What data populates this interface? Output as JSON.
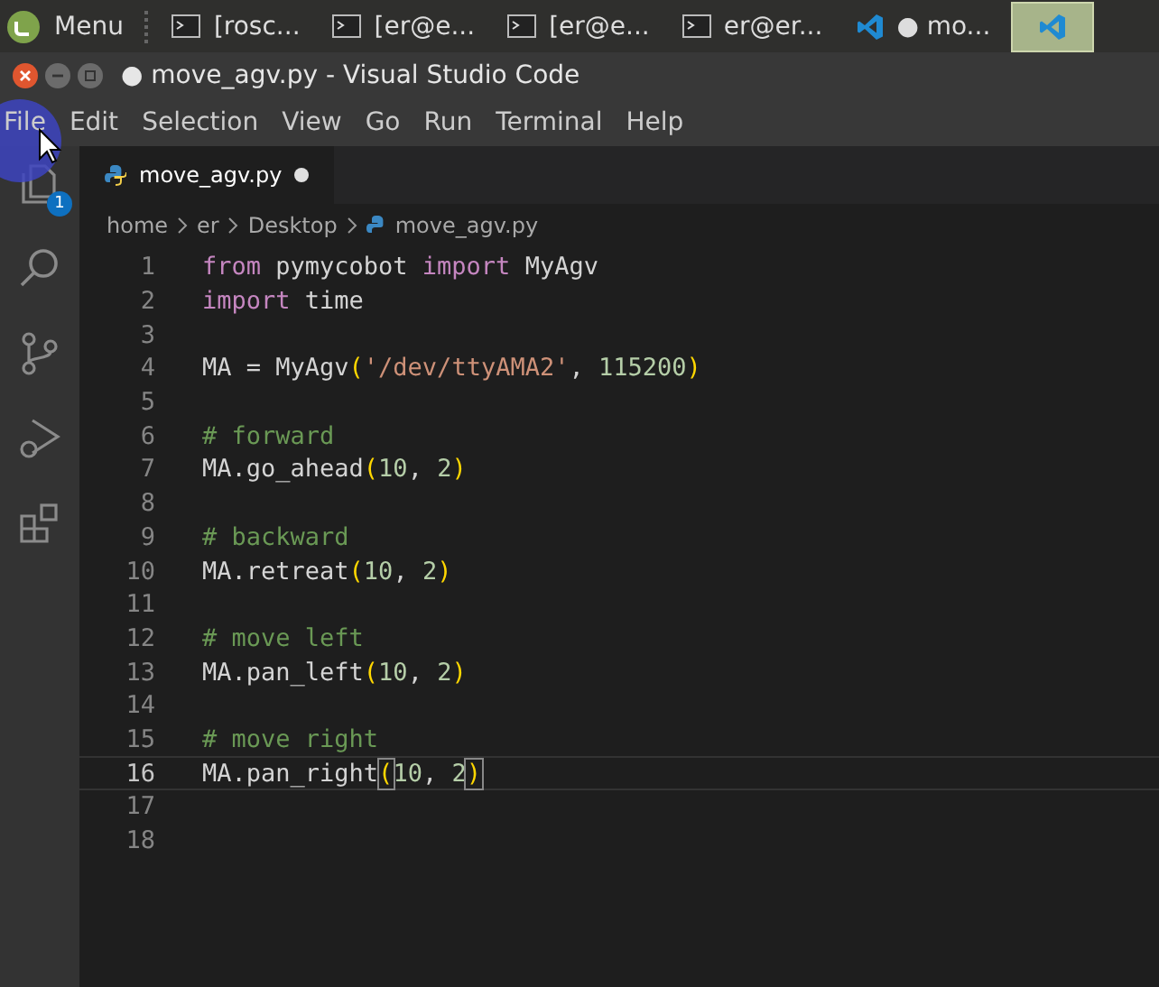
{
  "taskbar": {
    "menu_label": "Menu",
    "tasks": [
      {
        "kind": "terminal",
        "label": "[rosc...",
        "selected": false
      },
      {
        "kind": "terminal",
        "label": "[er@e...",
        "selected": false
      },
      {
        "kind": "terminal",
        "label": "[er@e...",
        "selected": false
      },
      {
        "kind": "terminal",
        "label": "er@er...",
        "selected": false
      },
      {
        "kind": "vscode",
        "label": "● mo...",
        "selected": false
      },
      {
        "kind": "vscode",
        "selected": true
      }
    ]
  },
  "window": {
    "title": "● move_agv.py - Visual Studio Code"
  },
  "menu_bar": [
    "File",
    "Edit",
    "Selection",
    "View",
    "Go",
    "Run",
    "Terminal",
    "Help"
  ],
  "activity_bar": [
    {
      "kind": "explorer",
      "badge": "1"
    },
    {
      "kind": "search"
    },
    {
      "kind": "source-control"
    },
    {
      "kind": "run-debug"
    },
    {
      "kind": "extensions"
    }
  ],
  "tabs": [
    {
      "label": "move_agv.py",
      "modified": true,
      "selected": true
    }
  ],
  "breadcrumbs": [
    "home",
    "er",
    "Desktop",
    "move_agv.py"
  ],
  "editor": {
    "lines": [
      {
        "number": "1",
        "selected": false,
        "tokens": [
          {
            "kind": "keyword",
            "text": "from"
          },
          {
            "kind": "plain",
            "text": " pymycobot "
          },
          {
            "kind": "keyword",
            "text": "import"
          },
          {
            "kind": "plain",
            "text": " MyAgv"
          }
        ]
      },
      {
        "number": "2",
        "selected": false,
        "tokens": [
          {
            "kind": "keyword",
            "text": "import"
          },
          {
            "kind": "plain",
            "text": " time"
          }
        ]
      },
      {
        "number": "3",
        "selected": false
      },
      {
        "number": "4",
        "selected": false,
        "tokens": [
          {
            "kind": "plain",
            "text": "MA = MyAgv"
          },
          {
            "kind": "bracket",
            "text": "("
          },
          {
            "kind": "string",
            "text": "'/dev/ttyAMA2'"
          },
          {
            "kind": "plain",
            "text": ", "
          },
          {
            "kind": "number",
            "text": "115200"
          },
          {
            "kind": "bracket",
            "text": ")"
          }
        ]
      },
      {
        "number": "5",
        "selected": false
      },
      {
        "number": "6",
        "selected": false,
        "tokens": [
          {
            "kind": "comment",
            "text": "# forward"
          }
        ]
      },
      {
        "number": "7",
        "selected": false,
        "tokens": [
          {
            "kind": "plain",
            "text": "MA.go_ahead"
          },
          {
            "kind": "bracket",
            "text": "("
          },
          {
            "kind": "number",
            "text": "10"
          },
          {
            "kind": "plain",
            "text": ", "
          },
          {
            "kind": "number",
            "text": "2"
          },
          {
            "kind": "bracket",
            "text": ")"
          }
        ]
      },
      {
        "number": "8",
        "selected": false
      },
      {
        "number": "9",
        "selected": false,
        "tokens": [
          {
            "kind": "comment",
            "text": "# backward"
          }
        ]
      },
      {
        "number": "10",
        "selected": false,
        "tokens": [
          {
            "kind": "plain",
            "text": "MA.retreat"
          },
          {
            "kind": "bracket",
            "text": "("
          },
          {
            "kind": "number",
            "text": "10"
          },
          {
            "kind": "plain",
            "text": ", "
          },
          {
            "kind": "number",
            "text": "2"
          },
          {
            "kind": "bracket",
            "text": ")"
          }
        ]
      },
      {
        "number": "11",
        "selected": false
      },
      {
        "number": "12",
        "selected": false,
        "tokens": [
          {
            "kind": "comment",
            "text": "# move left"
          }
        ]
      },
      {
        "number": "13",
        "selected": false,
        "tokens": [
          {
            "kind": "plain",
            "text": "MA.pan_left"
          },
          {
            "kind": "bracket",
            "text": "("
          },
          {
            "kind": "number",
            "text": "10"
          },
          {
            "kind": "plain",
            "text": ", "
          },
          {
            "kind": "number",
            "text": "2"
          },
          {
            "kind": "bracket",
            "text": ")"
          }
        ]
      },
      {
        "number": "14",
        "selected": false
      },
      {
        "number": "15",
        "selected": false,
        "tokens": [
          {
            "kind": "comment",
            "text": "# move right"
          }
        ]
      },
      {
        "number": "16",
        "selected": true,
        "tokens": [
          {
            "kind": "plain",
            "text": "MA.pan_right"
          },
          {
            "kind": "bracket-match",
            "text": "("
          },
          {
            "kind": "number",
            "text": "10"
          },
          {
            "kind": "plain",
            "text": ", "
          },
          {
            "kind": "number",
            "text": "2"
          },
          {
            "kind": "bracket-match",
            "text": ")"
          }
        ]
      },
      {
        "number": "17",
        "selected": false
      },
      {
        "number": "18",
        "selected": false
      }
    ]
  }
}
